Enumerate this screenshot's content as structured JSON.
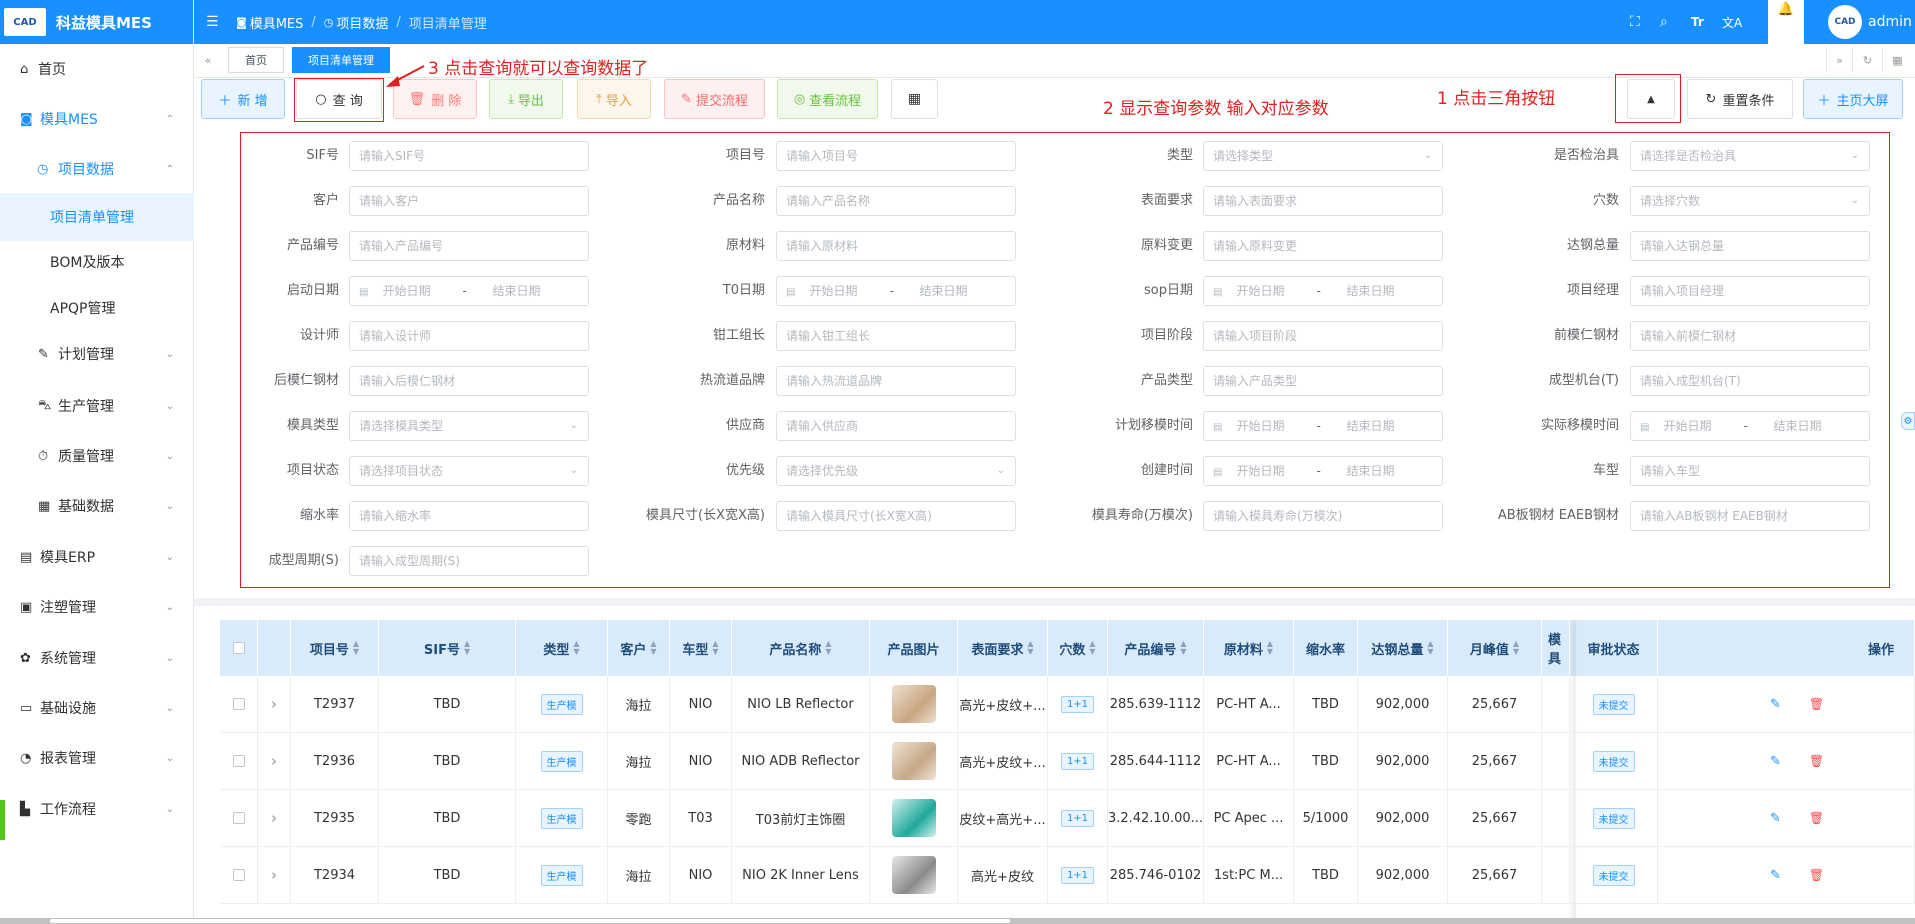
{
  "app": {
    "logo_text": "CAD",
    "title": "科益模具MES",
    "user": "admin"
  },
  "sidebar": [
    {
      "icon": "home-icon",
      "label": "首页"
    },
    {
      "icon": "camera-icon",
      "label": "模具MES"
    },
    {
      "icon": "clock-icon",
      "label": "项目数据"
    },
    {
      "label": "项目清单管理"
    },
    {
      "label": "BOM及版本"
    },
    {
      "label": "APQP管理"
    },
    {
      "icon": "edit-icon",
      "label": "计划管理"
    },
    {
      "icon": "cart-icon",
      "label": "生产管理"
    },
    {
      "icon": "timer-icon",
      "label": "质量管理"
    },
    {
      "icon": "calendar-icon",
      "label": "基础数据"
    },
    {
      "icon": "folder-icon",
      "label": "模具ERP"
    },
    {
      "icon": "box-icon",
      "label": "注塑管理"
    },
    {
      "icon": "gear-icon",
      "label": "系统管理"
    },
    {
      "icon": "monitor-icon",
      "label": "基础设施"
    },
    {
      "icon": "chart-icon",
      "label": "报表管理"
    },
    {
      "icon": "flow-icon",
      "label": "工作流程"
    }
  ],
  "breadcrumb": [
    "模具MES",
    "/",
    "项目数据",
    "/",
    "项目清单管理"
  ],
  "tags": [
    "首页",
    "项目清单管理"
  ],
  "toolbar": {
    "add": "新 增",
    "query": "查 询",
    "delete": "删 除",
    "export": "导出",
    "import": "导入",
    "submit": "提交流程",
    "flow": "查看流程",
    "reset": "重置条件",
    "bigscreen": "主页大屏"
  },
  "annotations": {
    "a1": "1 点击三角按钮",
    "a2": "2 显示查询参数 输入对应参数",
    "a3": "3 点击查询就可以查询数据了"
  },
  "filters": [
    [
      {
        "l": "SIF号",
        "p": "请输入SIF号"
      },
      {
        "l": "项目号",
        "p": "请输入项目号"
      },
      {
        "l": "类型",
        "p": "请选择类型",
        "s": 1
      },
      {
        "l": "是否检治具",
        "p": "请选择是否检治具",
        "s": 1
      }
    ],
    [
      {
        "l": "客户",
        "p": "请输入客户"
      },
      {
        "l": "产品名称",
        "p": "请输入产品名称"
      },
      {
        "l": "表面要求",
        "p": "请输入表面要求"
      },
      {
        "l": "穴数",
        "p": "请选择穴数",
        "s": 1
      }
    ],
    [
      {
        "l": "产品编号",
        "p": "请输入产品编号"
      },
      {
        "l": "原材料",
        "p": "请输入原材料"
      },
      {
        "l": "原料变更",
        "p": "请输入原料变更"
      },
      {
        "l": "达钢总量",
        "p": "请输入达钢总量"
      }
    ],
    [
      {
        "l": "启动日期",
        "d": 1
      },
      {
        "l": "T0日期",
        "d": 1
      },
      {
        "l": "sop日期",
        "d": 1
      },
      {
        "l": "项目经理",
        "p": "请输入项目经理"
      }
    ],
    [
      {
        "l": "设计师",
        "p": "请输入设计师"
      },
      {
        "l": "钳工组长",
        "p": "请输入钳工组长"
      },
      {
        "l": "项目阶段",
        "p": "请输入项目阶段"
      },
      {
        "l": "前模仁钢材",
        "p": "请输入前模仁钢材"
      }
    ],
    [
      {
        "l": "后模仁钢材",
        "p": "请输入后模仁钢材"
      },
      {
        "l": "热流道品牌",
        "p": "请输入热流道品牌"
      },
      {
        "l": "产品类型",
        "p": "请输入产品类型"
      },
      {
        "l": "成型机台(T)",
        "p": "请输入成型机台(T)"
      }
    ],
    [
      {
        "l": "模具类型",
        "p": "请选择模具类型",
        "s": 1
      },
      {
        "l": "供应商",
        "p": "请输入供应商"
      },
      {
        "l": "计划移模时间",
        "d": 1
      },
      {
        "l": "实际移模时间",
        "d": 1
      }
    ],
    [
      {
        "l": "项目状态",
        "p": "请选择项目状态",
        "s": 1
      },
      {
        "l": "优先级",
        "p": "请选择优先级",
        "s": 1
      },
      {
        "l": "创建时间",
        "d": 1
      },
      {
        "l": "车型",
        "p": "请输入车型"
      }
    ],
    [
      {
        "l": "缩水率",
        "p": "请输入缩水率"
      },
      {
        "l": "模具尺寸(长X宽X高)",
        "p": "请输入模具尺寸(长X宽X高)"
      },
      {
        "l": "模具寿命(万模次)",
        "p": "请输入模具寿命(万模次)"
      },
      {
        "l": "AB板钢材 EAEB钢材",
        "p": "请输入AB板钢材    EAEB钢材"
      }
    ],
    [
      {
        "l": "成型周期(S)",
        "p": "请输入成型周期(S)"
      }
    ]
  ],
  "date": {
    "start": "开始日期",
    "sep": "-",
    "end": "结束日期"
  },
  "table": {
    "headers": [
      "项目号",
      "SIF号",
      "类型",
      "客户",
      "车型",
      "产品名称",
      "产品图片",
      "表面要求",
      "穴数",
      "产品编号",
      "原材料",
      "缩水率",
      "达钢总量",
      "月峰值",
      "模具",
      "审批状态",
      "操作"
    ],
    "rows": [
      [
        "T2937",
        "TBD",
        "生产模",
        "海拉",
        "NIO",
        "NIO LB Reflector",
        "",
        "高光+皮纹+...",
        "1+1",
        "285.639-1112",
        "PC-HT A...",
        "TBD",
        "902,000",
        "25,667",
        "",
        "未提交"
      ],
      [
        "T2936",
        "TBD",
        "生产模",
        "海拉",
        "NIO",
        "NIO ADB Reflector",
        "",
        "高光+皮纹+...",
        "1+1",
        "285.644-1112",
        "PC-HT A...",
        "TBD",
        "902,000",
        "25,667",
        "",
        "未提交"
      ],
      [
        "T2935",
        "TBD",
        "生产模",
        "零跑",
        "T03",
        "T03前灯主饰圈",
        "",
        "皮纹+高光+...",
        "1+1",
        "3.2.42.10.00...",
        "PC Apec ...",
        "5/1000",
        "902,000",
        "25,667",
        "",
        "未提交"
      ],
      [
        "T2934",
        "TBD",
        "生产模",
        "海拉",
        "NIO",
        "NIO 2K Inner Lens",
        "",
        "高光+皮纹",
        "1+1",
        "285.746-0102",
        "1st:PC M...",
        "TBD",
        "902,000",
        "25,667",
        "",
        "未提交"
      ]
    ]
  },
  "colors": {
    "primary": "#1890ff",
    "danger": "#ff4d4f",
    "annotation": "#e02020"
  }
}
